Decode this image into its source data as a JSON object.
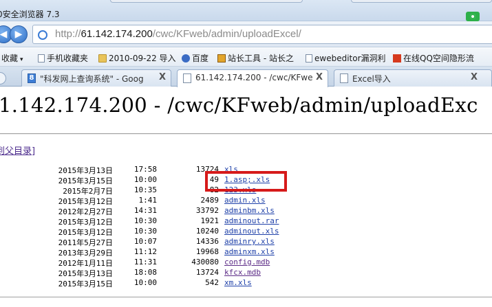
{
  "window": {
    "title": "0安全浏览器 7.3"
  },
  "nav": {
    "back_glyph": "◀",
    "forward_glyph": "▶",
    "url_scheme": "http://",
    "url_host": "61.142.174.200",
    "url_path": "/cwc/KFweb/admin/uploadExcel/"
  },
  "favorites": [
    {
      "label": "收藏",
      "icon": "none",
      "caret": "▾"
    },
    {
      "label": "手机收藏夹",
      "icon": "page"
    },
    {
      "label": "2010-09-22 导入",
      "icon": "folder"
    },
    {
      "label": "百度",
      "icon": "paw"
    },
    {
      "label": "站长工具 - 站长之",
      "icon": "tool"
    },
    {
      "label": "ewebeditor漏洞利",
      "icon": "page"
    },
    {
      "label": "在线QQ空间隐形流",
      "icon": "qq"
    }
  ],
  "tabs": [
    {
      "label": "\"科发网上查询系统\" - Goog",
      "close": "X",
      "active": false
    },
    {
      "label": "61.142.174.200 - /cwc/KFweb",
      "close": "X",
      "active": true
    },
    {
      "label": "Excel导入",
      "close": "X",
      "active": false
    }
  ],
  "page": {
    "heading": "1.142.174.200 - /cwc/KFweb/admin/uploadExc",
    "parent_link": "到父目录]"
  },
  "files": [
    {
      "date": "2015年3月13日",
      "time": "17:58",
      "size": "13724",
      "name": "xls"
    },
    {
      "date": "2015年3月15日",
      "time": "10:00",
      "size": "49",
      "name": "1.asp;.xls"
    },
    {
      "date": "2015年2月7日",
      "time": "10:35",
      "size": "82",
      "name": "123.xls"
    },
    {
      "date": "2015年3月12日",
      "time": "1:41",
      "size": "2489",
      "name": "admin.xls"
    },
    {
      "date": "2012年2月27日",
      "time": "14:31",
      "size": "33792",
      "name": "adminbm.xls"
    },
    {
      "date": "2015年3月12日",
      "time": "10:30",
      "size": "1921",
      "name": "adminout.rar"
    },
    {
      "date": "2015年3月12日",
      "time": "10:30",
      "size": "10240",
      "name": "adminout.xls"
    },
    {
      "date": "2011年5月27日",
      "time": "10:07",
      "size": "14336",
      "name": "adminry.xls"
    },
    {
      "date": "2013年3月29日",
      "time": "11:12",
      "size": "19968",
      "name": "adminxm.xls"
    },
    {
      "date": "2012年1月11日",
      "time": "11:31",
      "size": "430080",
      "name": "config.mdb"
    },
    {
      "date": "2015年3月13日",
      "time": "18:08",
      "size": "13724",
      "name": "kfcx.mdb"
    },
    {
      "date": "2015年3月15日",
      "time": "10:00",
      "size": "542",
      "name": "xm.xls"
    }
  ],
  "colors": {
    "highlight_box": "#d61a1a",
    "link": "#1d3fa8",
    "visited_link": "#5b2a86"
  }
}
